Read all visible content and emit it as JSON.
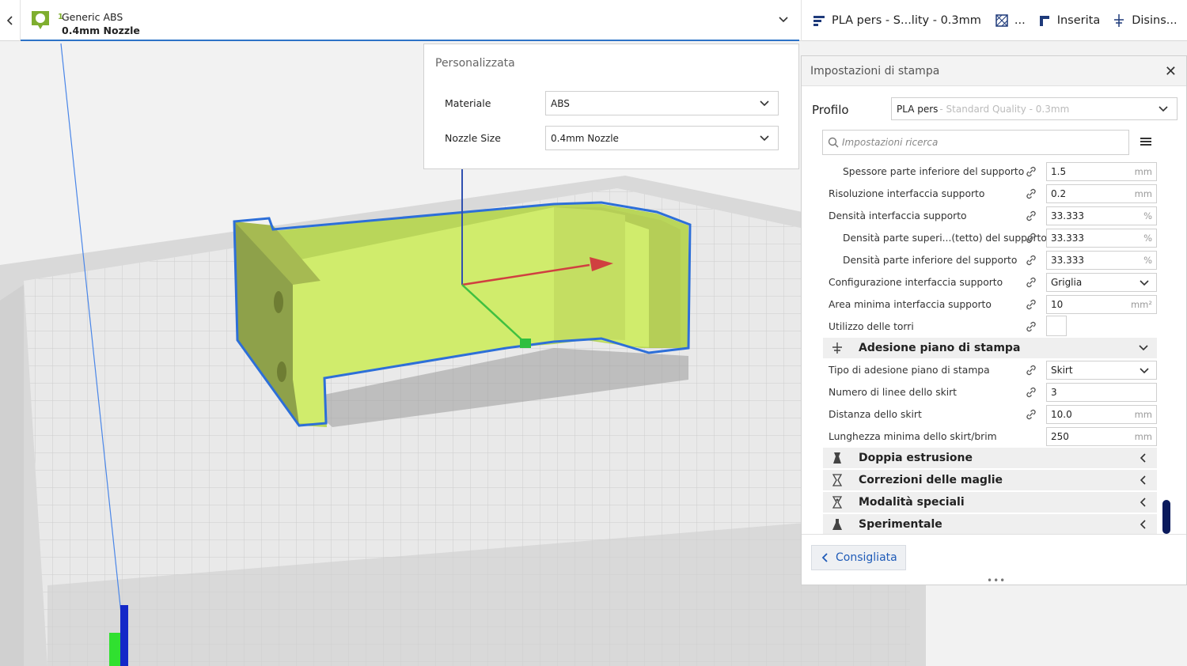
{
  "topbar": {
    "back_icon": "chevron-left-icon",
    "extruder": {
      "number": "1",
      "material": "Generic ABS",
      "nozzle": "0.4mm Nozzle",
      "accent_color": "#7fae2f"
    },
    "print_setup": {
      "profile_summary": "PLA pers - S...lity - 0.3mm",
      "infill_label": "...",
      "support_label": "Inserita",
      "adhesion_label": "Disins...",
      "edit_icon": "pencil-icon"
    }
  },
  "popup": {
    "title": "Personalizzata",
    "material_label": "Materiale",
    "material_value": "ABS",
    "nozzle_label": "Nozzle Size",
    "nozzle_value": "0.4mm Nozzle"
  },
  "panel": {
    "title": "Impostazioni di stampa",
    "profile_label": "Profilo",
    "profile_name": "PLA pers",
    "profile_sub": " - Standard Quality - 0.3mm",
    "search_placeholder": "Impostazioni ricerca",
    "settings": [
      {
        "label": "Spessore parte inferiore del supporto",
        "value": "1.5",
        "unit": "mm"
      },
      {
        "label": "Risoluzione interfaccia supporto",
        "value": "0.2",
        "unit": "mm"
      },
      {
        "label": "Densità interfaccia supporto",
        "value": "33.333",
        "unit": "%"
      },
      {
        "label": "Densità parte superi...(tetto) del supporto",
        "value": "33.333",
        "unit": "%"
      },
      {
        "label": "Densità parte inferiore del supporto",
        "value": "33.333",
        "unit": "%"
      },
      {
        "label": "Configurazione interfaccia supporto",
        "value": "Griglia",
        "unit": ""
      },
      {
        "label": "Area minima interfaccia supporto",
        "value": "10",
        "unit": "mm²"
      },
      {
        "label": "Utilizzo delle torri",
        "value": "",
        "unit": ""
      }
    ],
    "adhesion_category": "Adesione piano di stampa",
    "adhesion_settings": [
      {
        "label": "Tipo di adesione piano di stampa",
        "value": "Skirt",
        "unit": ""
      },
      {
        "label": "Numero di linee dello skirt",
        "value": "3",
        "unit": ""
      },
      {
        "label": "Distanza dello skirt",
        "value": "10.0",
        "unit": "mm"
      },
      {
        "label": "Lunghezza minima dello skirt/brim",
        "value": "250",
        "unit": "mm"
      }
    ],
    "categories": [
      {
        "label": "Doppia estrusione",
        "icon": "dual-extrusion-icon"
      },
      {
        "label": "Correzioni delle maglie",
        "icon": "mesh-fixes-icon"
      },
      {
        "label": "Modalità speciali",
        "icon": "special-modes-icon"
      },
      {
        "label": "Sperimentale",
        "icon": "experimental-icon"
      }
    ],
    "recommended_button": "Consigliata",
    "drag_handle": "•••"
  },
  "colors": {
    "model": "#c9e86a",
    "model_side": "#8fa046",
    "outline": "#2d6fd8",
    "bed": "#d5d5d5",
    "accent_blue": "#1f5bb8"
  }
}
